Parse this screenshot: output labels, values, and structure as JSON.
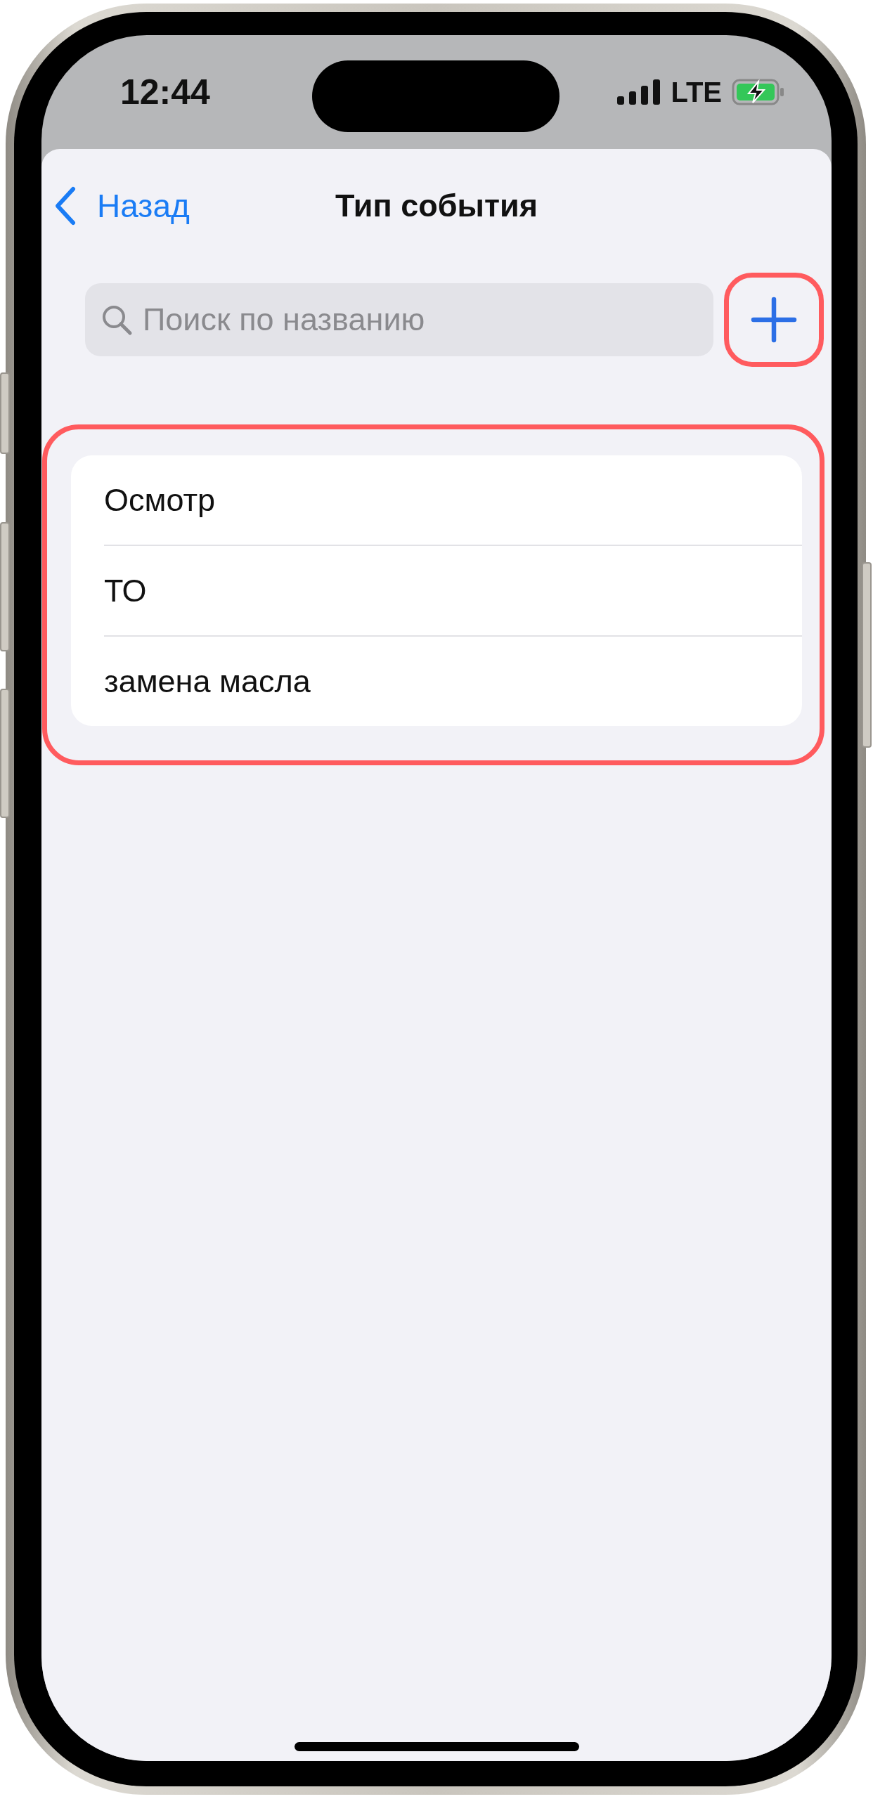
{
  "status_bar": {
    "time": "12:44",
    "network": "LTE",
    "charging": true
  },
  "nav": {
    "back": "Назад",
    "title": "Тип события"
  },
  "search": {
    "placeholder": "Поиск по названию"
  },
  "add_button": {
    "highlighted": true
  },
  "list": {
    "highlighted": true,
    "items": [
      {
        "label": "Осмотр"
      },
      {
        "label": "ТО"
      },
      {
        "label": "замена масла"
      }
    ]
  }
}
